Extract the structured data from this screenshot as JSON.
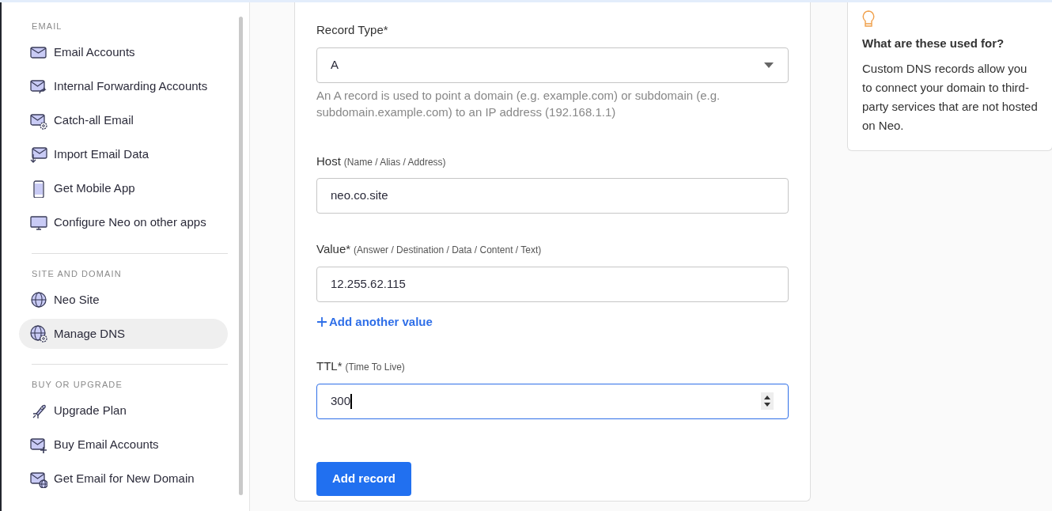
{
  "sidebar": {
    "sections": [
      {
        "heading": "EMAIL",
        "items": [
          {
            "label": "Email Accounts",
            "selected": false
          },
          {
            "label": "Internal Forwarding Accounts",
            "selected": false
          },
          {
            "label": "Catch-all Email",
            "selected": false
          },
          {
            "label": "Import Email Data",
            "selected": false
          },
          {
            "label": "Get Mobile App",
            "selected": false
          },
          {
            "label": "Configure Neo on other apps",
            "selected": false
          }
        ]
      },
      {
        "heading": "SITE AND DOMAIN",
        "items": [
          {
            "label": "Neo Site",
            "selected": false
          },
          {
            "label": "Manage DNS",
            "selected": true
          }
        ]
      },
      {
        "heading": "BUY OR UPGRADE",
        "items": [
          {
            "label": "Upgrade Plan",
            "selected": false
          },
          {
            "label": "Buy Email Accounts",
            "selected": false
          },
          {
            "label": "Get Email for New Domain",
            "selected": false
          }
        ]
      }
    ]
  },
  "form": {
    "fields": [
      {
        "kind": "select",
        "label": "Record Type*",
        "value": "A",
        "help": "An A record is used to point a domain (e.g. example.com) or subdomain (e.g. subdomain.example.com) to an IP address (192.168.1.1)",
        "focused": false
      },
      {
        "kind": "text",
        "label": "Host",
        "hint": "(Name / Alias / Address)",
        "value": "neo.co.site",
        "focused": false
      },
      {
        "kind": "text",
        "label": "Value*",
        "hint": "(Answer / Destination / Data / Content / Text)",
        "value": "12.255.62.115",
        "link": "Add another value",
        "focused": false
      },
      {
        "kind": "number",
        "label": "TTL*",
        "hint": "(Time To Live)",
        "value": "300",
        "focused": true
      }
    ],
    "submit": "Add record"
  },
  "info": {
    "title": "What are these used for?",
    "text": "Custom DNS records allow you to connect your domain to third-party services that are not hosted on Neo."
  }
}
